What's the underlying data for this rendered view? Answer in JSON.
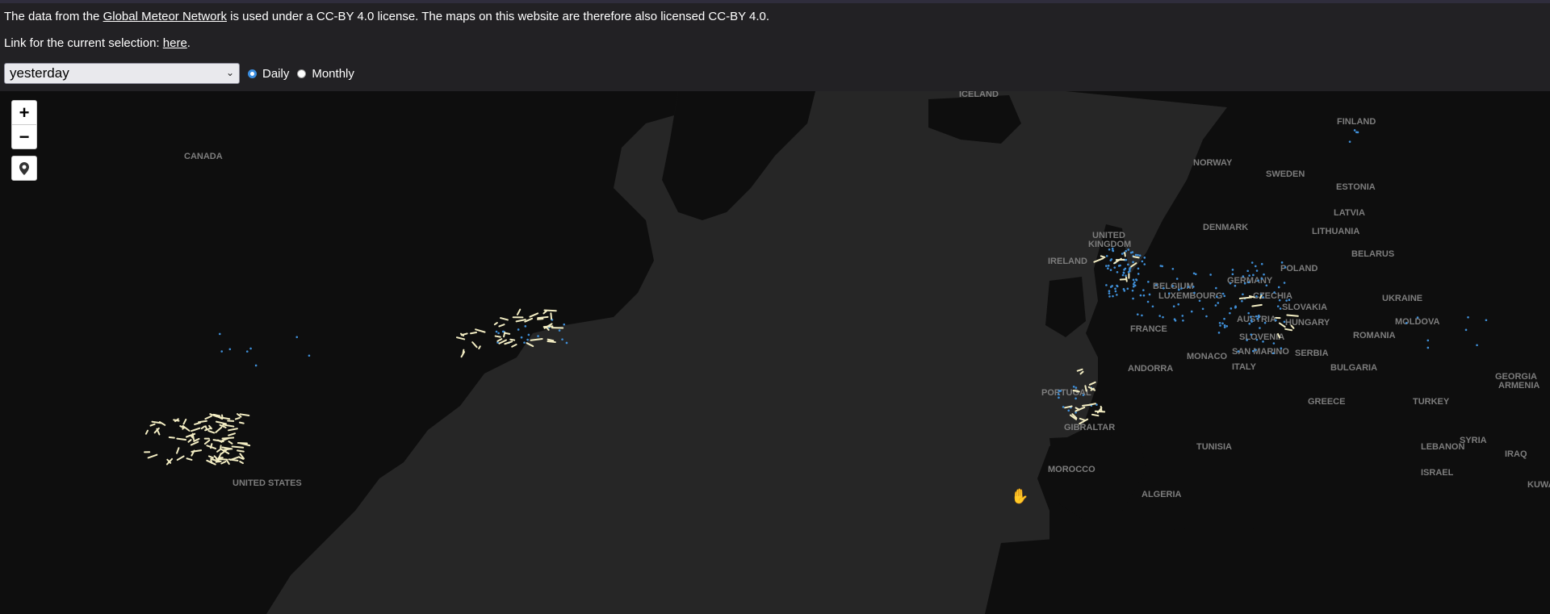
{
  "notice": {
    "prefix": "The data from the ",
    "link": "Global Meteor Network",
    "suffix": " is used under a CC-BY 4.0 license. The maps on this website are therefore also licensed CC-BY 4.0."
  },
  "selection": {
    "prefix": "Link for the current selection: ",
    "link": "here",
    "suffix": "."
  },
  "controls": {
    "period_value": "yesterday",
    "radio_daily": "Daily",
    "radio_monthly": "Monthly",
    "selected": "Daily"
  },
  "zoom": {
    "in": "+",
    "out": "−"
  },
  "map": {
    "labels": {
      "canada": "CANADA",
      "united_states": "UNITED STATES",
      "iceland": "ICELAND",
      "finland": "FINLAND",
      "norway": "NORWAY",
      "sweden": "SWEDEN",
      "estonia": "ESTONIA",
      "latvia": "LATVIA",
      "lithuania": "LITHUANIA",
      "belarus": "BELARUS",
      "denmark": "DENMARK",
      "united_kingdom_1": "UNITED",
      "united_kingdom_2": "KINGDOM",
      "ireland": "IRELAND",
      "poland": "POLAND",
      "germany": "GERMANY",
      "belgium": "BELGIUM",
      "luxembourg": "LUXEMBOURG",
      "czechia": "CZECHIA",
      "slovakia": "SLOVAKIA",
      "ukraine": "UKRAINE",
      "moldova": "MOLDOVA",
      "austria": "AUSTRIA",
      "hungary": "HUNGARY",
      "france": "FRANCE",
      "romania": "ROMANIA",
      "slovenia": "SLOVENIA",
      "san_marino": "SAN MARINO",
      "monaco": "MONACO",
      "serbia": "SERBIA",
      "andorra": "ANDORRA",
      "italy": "ITALY",
      "bulgaria": "BULGARIA",
      "georgia": "GEORGIA",
      "armenia": "ARMENIA",
      "portugal": "PORTUGAL",
      "greece": "GREECE",
      "turkey": "TURKEY",
      "gibraltar": "GIBRALTAR",
      "tunisia": "TUNISIA",
      "syria": "SYRIA",
      "lebanon": "LEBANON",
      "iraq": "IRAQ",
      "israel": "ISRAEL",
      "kuwait": "KUWA",
      "morocco": "MOROCCO",
      "algeria": "ALGERIA"
    },
    "colors": {
      "ocean": "#262626",
      "land": "#0e0e0e",
      "label": "#7d7d7d",
      "station": "#3f8fd8",
      "meteor": "#f3edc3"
    }
  }
}
